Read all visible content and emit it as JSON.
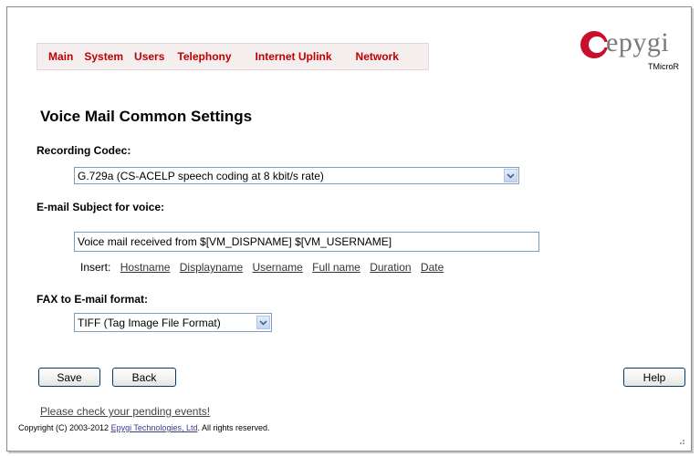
{
  "menu": [
    "Main",
    "System",
    "Users",
    "Telephony",
    "Internet Uplink",
    "Network"
  ],
  "logo": {
    "text": "epygi",
    "subtext": "TMicroR"
  },
  "page_title": "Voice Mail Common Settings",
  "recording_codec": {
    "label": "Recording Codec:",
    "value": "G.729a (CS-ACELP speech coding at 8 kbit/s rate)"
  },
  "email_subject": {
    "label": "E-mail Subject for voice:",
    "value": "Voice mail received from $[VM_DISPNAME] $[VM_USERNAME]"
  },
  "insert": {
    "label": "Insert:",
    "links": [
      "Hostname",
      "Displayname",
      "Username",
      "Full name",
      "Duration",
      "Date"
    ]
  },
  "fax_format": {
    "label": "FAX to E-mail format:",
    "value": "TIFF (Tag Image File Format)"
  },
  "buttons": {
    "save": "Save",
    "back": "Back",
    "help": "Help"
  },
  "pending_link": "Please check your pending events!",
  "copyright": {
    "prefix": "Copyright (C) 2003-2012 ",
    "company": "Epygi Technologies, Ltd",
    "suffix": ". All rights reserved."
  },
  "colors": {
    "menu_text": "#c00000",
    "menu_bg": "#f4eeee",
    "logo_red": "#c8102e"
  }
}
